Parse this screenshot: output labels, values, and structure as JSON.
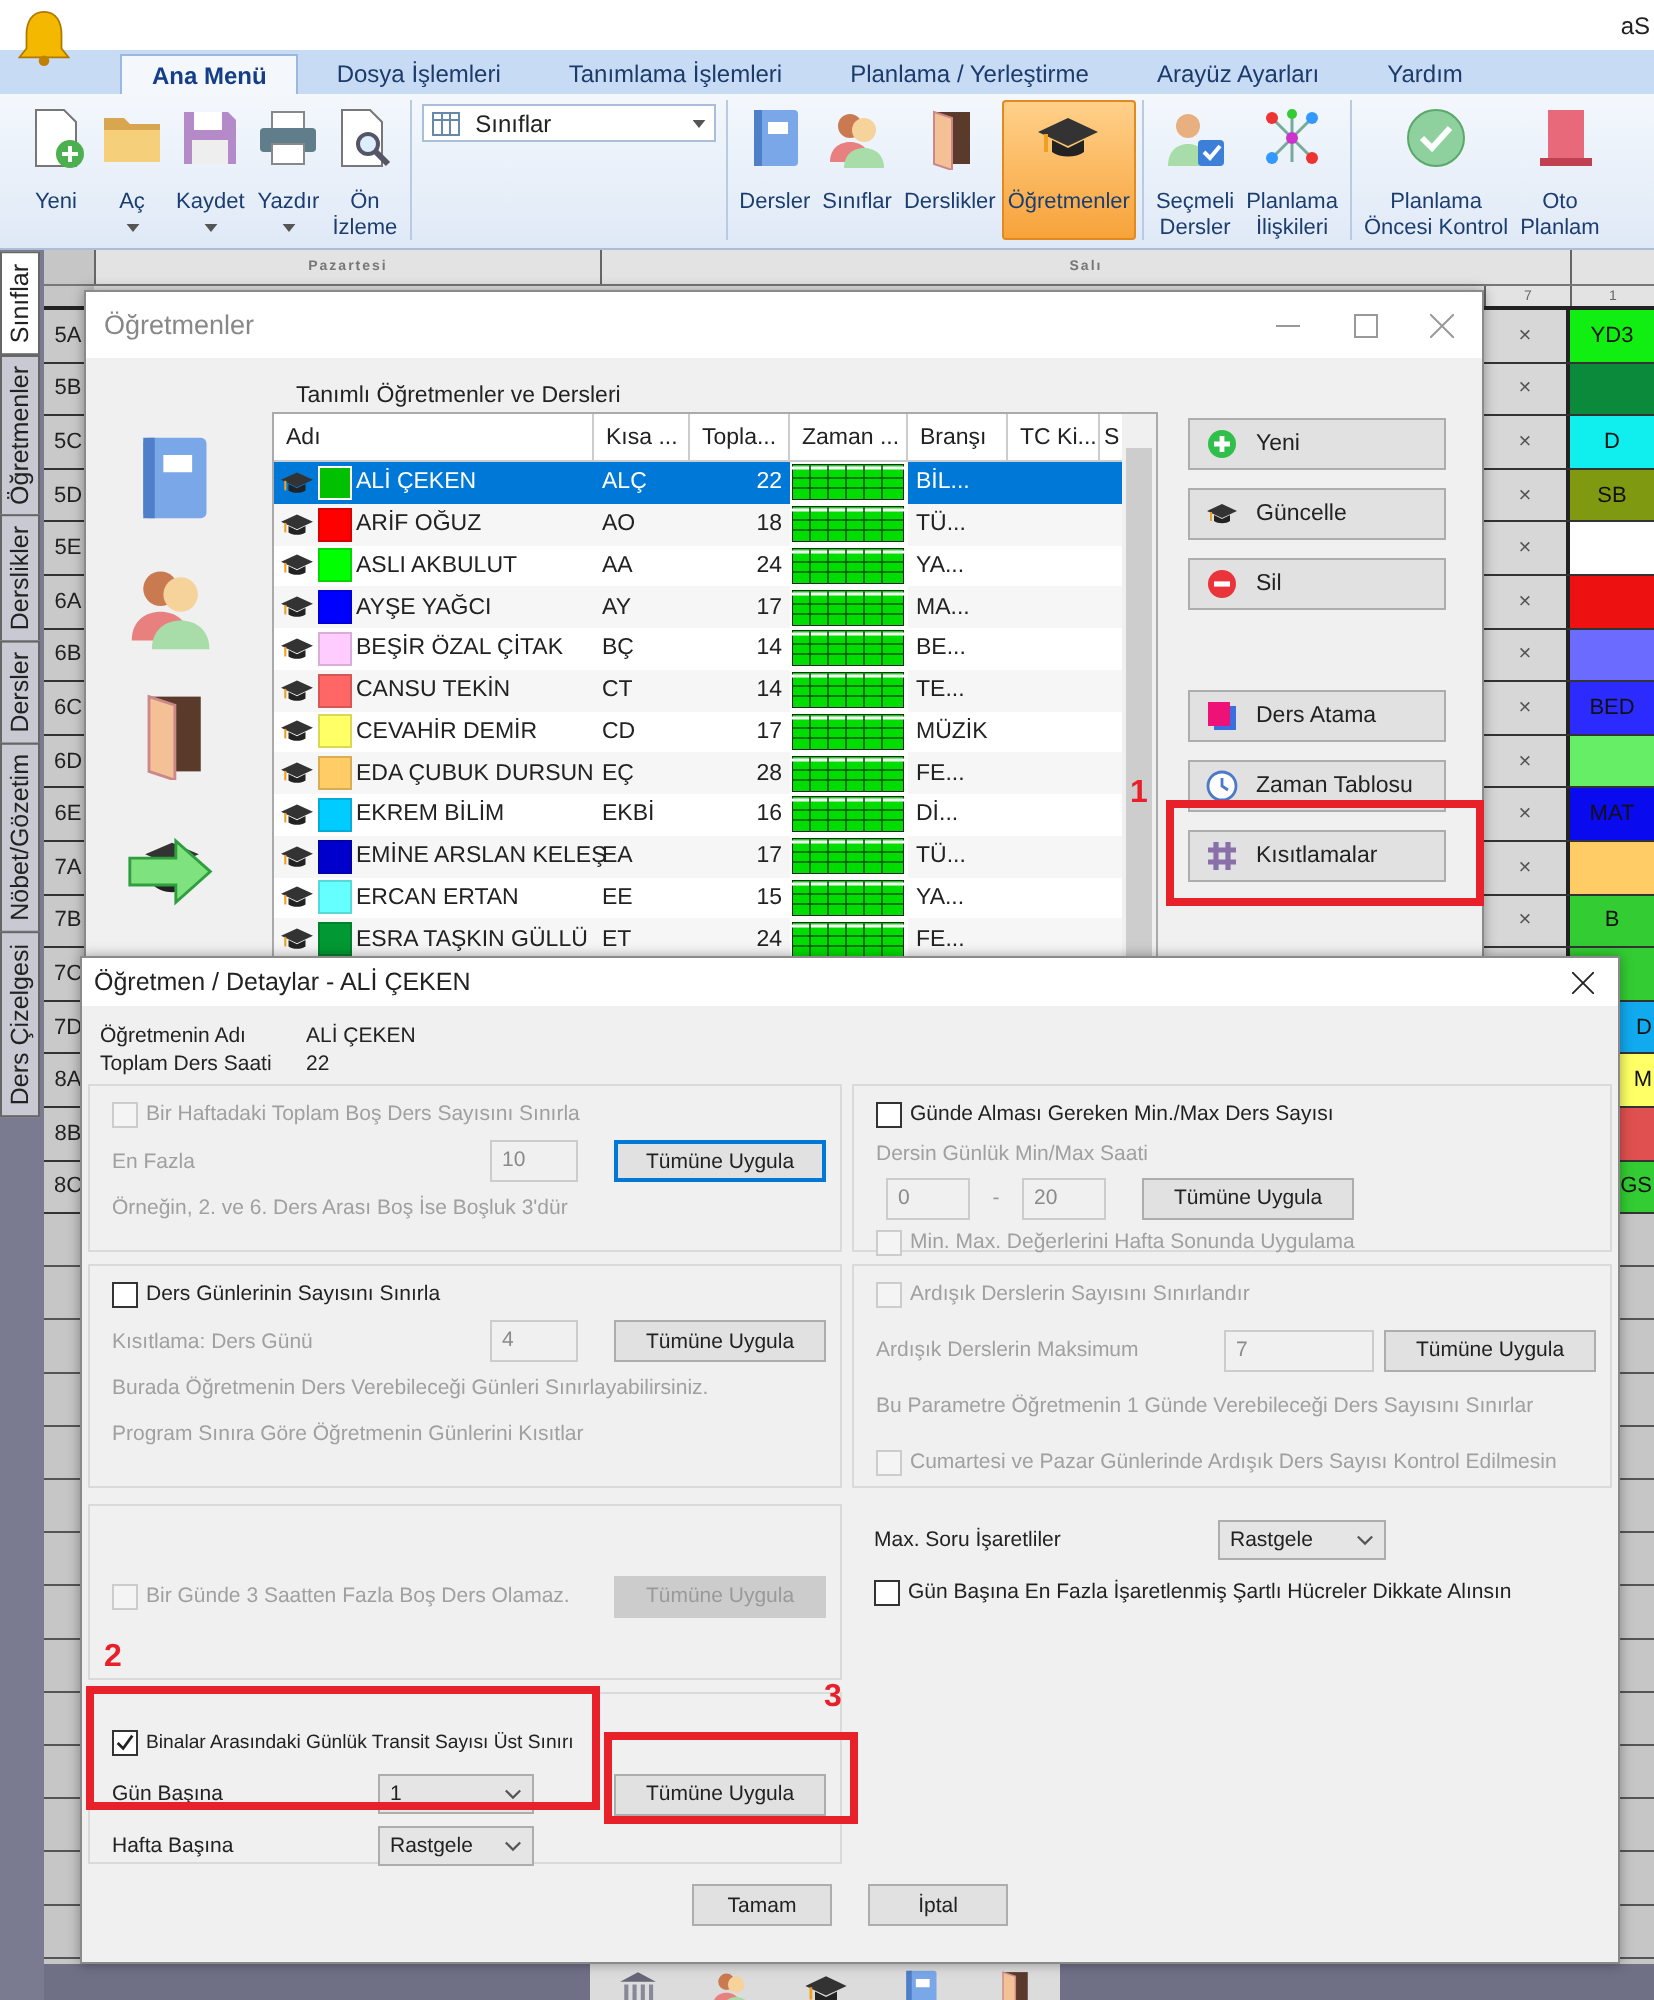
{
  "app": {
    "title": "aS"
  },
  "ribbon": {
    "tabs": [
      {
        "label": "Ana Menü",
        "selected": true
      },
      {
        "label": "Dosya İşlemleri",
        "selected": false
      },
      {
        "label": "Tanımlama İşlemleri",
        "selected": false
      },
      {
        "label": "Planlama / Yerleştirme",
        "selected": false
      },
      {
        "label": "Arayüz Ayarları",
        "selected": false
      },
      {
        "label": "Yardım",
        "selected": false
      }
    ],
    "groups": [
      {
        "kind": "buttons",
        "items": [
          {
            "label": "Yeni",
            "dropdown": false,
            "selected": false
          },
          {
            "label": "Aç",
            "dropdown": true,
            "selected": false
          },
          {
            "label": "Kaydet",
            "dropdown": true,
            "selected": false
          },
          {
            "label": "Yazdır",
            "dropdown": true,
            "selected": false
          },
          {
            "label": "Ön\nİzleme",
            "dropdown": false,
            "selected": false
          }
        ]
      },
      {
        "kind": "combo",
        "value": "Sınıflar"
      },
      {
        "kind": "buttons",
        "items": [
          {
            "label": "Dersler",
            "dropdown": false,
            "selected": false
          },
          {
            "label": "Sınıflar",
            "dropdown": false,
            "selected": false
          },
          {
            "label": "Derslikler",
            "dropdown": false,
            "selected": false
          },
          {
            "label": "Öğretmenler",
            "dropdown": false,
            "selected": true
          }
        ]
      },
      {
        "kind": "buttons",
        "items": [
          {
            "label": "Seçmeli\nDersler",
            "dropdown": false,
            "selected": false
          },
          {
            "label": "Planlama\nİlişkileri",
            "dropdown": false,
            "selected": false
          }
        ]
      },
      {
        "kind": "buttons",
        "items": [
          {
            "label": "Planlama\nÖncesi Kontrol",
            "dropdown": false,
            "selected": false
          },
          {
            "label": "Oto\nPlanlam",
            "dropdown": false,
            "selected": false
          }
        ]
      }
    ]
  },
  "side_tabs": [
    {
      "label": "Sınıflar",
      "selected": true
    },
    {
      "label": "Öğretmenler",
      "selected": false
    },
    {
      "label": "Derslikler",
      "selected": false
    },
    {
      "label": "Dersler",
      "selected": false
    },
    {
      "label": "Nöbet/Gözetim",
      "selected": false
    },
    {
      "label": "Ders Çizelgesi",
      "selected": false
    }
  ],
  "timetable": {
    "days": [
      "Pazartesi",
      "Salı"
    ],
    "periods": [
      "7",
      "1"
    ],
    "rows": [
      {
        "label": "5A",
        "mark": "×",
        "cell": "YD3",
        "color": "#11ee11"
      },
      {
        "label": "5B",
        "mark": "×",
        "color": "#0a8a3a"
      },
      {
        "label": "5C",
        "mark": "×",
        "cell": "D",
        "color": "#11eeee"
      },
      {
        "label": "5D",
        "mark": "×",
        "cell": "SB",
        "color": "#7f9a10"
      },
      {
        "label": "5E",
        "mark": "×",
        "color": "#ffffff"
      },
      {
        "label": "6A",
        "mark": "×",
        "color": "#ee1111"
      },
      {
        "label": "6B",
        "mark": "×",
        "color": "#6b6bff"
      },
      {
        "label": "6C",
        "mark": "×",
        "cell": "BED",
        "color": "#2b2bff"
      },
      {
        "label": "6D",
        "mark": "×",
        "color": "#66ee66"
      },
      {
        "label": "6E",
        "mark": "×",
        "cell": "MAT",
        "color": "#0a0aee"
      },
      {
        "label": "7A",
        "mark": "×",
        "color": "#ffcc66"
      },
      {
        "label": "7B",
        "mark": "×",
        "cell": "B",
        "color": "#33cc33"
      },
      {
        "label": "7C",
        "color": "#33cc33"
      },
      {
        "label": "7D",
        "cell": "D",
        "color": "#11aaee"
      },
      {
        "label": "8A",
        "cell": "M",
        "color": "#ffff66"
      },
      {
        "label": "8B",
        "color": "#e05050"
      },
      {
        "label": "8C",
        "cell": "GS",
        "color": "#33cc33"
      }
    ]
  },
  "teachers_window": {
    "title": "Öğretmenler",
    "caption": "Tanımlı Öğretmenler ve Dersleri",
    "columns": [
      "Adı",
      "Kısa ...",
      "Topla...",
      "Zaman ...",
      "Branşı",
      "TC Ki...",
      "S"
    ],
    "rows": [
      {
        "name": "ALİ ÇEKEN",
        "short": "ALÇ",
        "total": "22",
        "branch": "BİL...",
        "color": "#00c000",
        "selected": true
      },
      {
        "name": "ARİF OĞUZ",
        "short": "AO",
        "total": "18",
        "branch": "TÜ...",
        "color": "#ff0000",
        "selected": false
      },
      {
        "name": "ASLI AKBULUT",
        "short": "AA",
        "total": "24",
        "branch": "YA...",
        "color": "#00ff00",
        "selected": false
      },
      {
        "name": "AYŞE YAĞCI",
        "short": "AY",
        "total": "17",
        "branch": "MA...",
        "color": "#0000ff",
        "selected": false
      },
      {
        "name": "BEŞİR ÖZAL ÇİTAK",
        "short": "BÇ",
        "total": "14",
        "branch": "BE...",
        "color": "#ffccff",
        "selected": false
      },
      {
        "name": "CANSU TEKİN",
        "short": "CT",
        "total": "14",
        "branch": "TE...",
        "color": "#ff6666",
        "selected": false
      },
      {
        "name": "CEVAHİR DEMİR",
        "short": "CD",
        "total": "17",
        "branch": "MÜZİK",
        "color": "#ffff66",
        "selected": false
      },
      {
        "name": "EDA ÇUBUK DURSUN",
        "short": "EÇ",
        "total": "28",
        "branch": "FE...",
        "color": "#ffcc66",
        "selected": false
      },
      {
        "name": "EKREM BİLİM",
        "short": "EKBİ",
        "total": "16",
        "branch": "Dİ...",
        "color": "#00ccff",
        "selected": false
      },
      {
        "name": "EMİNE ARSLAN KELEŞ",
        "short": "EA",
        "total": "17",
        "branch": "TÜ...",
        "color": "#0000cc",
        "selected": false
      },
      {
        "name": "ERCAN ERTAN",
        "short": "EE",
        "total": "15",
        "branch": "YA...",
        "color": "#66ffff",
        "selected": false
      },
      {
        "name": "ESRA TAŞKIN GÜLLÜ",
        "short": "ET",
        "total": "24",
        "branch": "FE...",
        "color": "#009933",
        "selected": false
      }
    ],
    "buttons": [
      [
        "Yeni",
        "Güncelle",
        "Sil"
      ],
      [
        "Ders Atama",
        "Zaman Tablosu",
        "Kısıtlamalar"
      ]
    ]
  },
  "detail_dialog": {
    "title": "Öğretmen / Detaylar - ALİ ÇEKEN",
    "info": [
      {
        "label": "Öğretmenin Adı",
        "value": "ALİ ÇEKEN"
      },
      {
        "label": "Toplam Ders Saati",
        "value": "22"
      }
    ],
    "left_sections": [
      {
        "framed": true,
        "lines": [
          [
            {
              "kind": "checkbox",
              "label": "Bir Haftadaki Toplam Boş Ders Sayısını Sınırla",
              "checked": false,
              "disabled": true
            }
          ],
          [
            {
              "kind": "label",
              "text": "En Fazla",
              "disabled": true
            },
            {
              "kind": "input",
              "value": "10",
              "disabled": true
            },
            {
              "kind": "button",
              "label": "Tümüne Uygula",
              "focused": true,
              "disabled": false
            }
          ],
          [
            {
              "kind": "note",
              "text": "Örneğin, 2. ve 6. Ders Arası Boş İse Boşluk 3'dür",
              "disabled": true
            }
          ]
        ]
      },
      {
        "framed": true,
        "lines": [
          [
            {
              "kind": "checkbox",
              "label": "Ders Günlerinin Sayısını Sınırla",
              "checked": false,
              "disabled": false
            }
          ],
          [
            {
              "kind": "label",
              "text": "Kısıtlama: Ders Günü",
              "disabled": true
            },
            {
              "kind": "input",
              "value": "4",
              "disabled": true
            },
            {
              "kind": "button",
              "label": "Tümüne Uygula",
              "focused": false,
              "disabled": false
            }
          ],
          [
            {
              "kind": "note",
              "text": "Burada Öğretmenin Ders Verebileceği Günleri Sınırlayabilirsiniz.",
              "disabled": true
            }
          ],
          [
            {
              "kind": "note",
              "text": "Program Sınıra Göre Öğretmenin Günlerini Kısıtlar",
              "disabled": true
            }
          ]
        ]
      },
      {
        "framed": true,
        "lines": [
          [
            {
              "kind": "checkbox",
              "label": "Bir Günde 3 Saatten Fazla Boş Ders Olamaz.",
              "checked": false,
              "disabled": true
            },
            {
              "kind": "button",
              "label": "Tümüne Uygula",
              "focused": false,
              "disabled": true
            }
          ]
        ]
      },
      {
        "framed": true,
        "lines": [
          [
            {
              "kind": "checkbox",
              "label": "Binalar Arasındaki Günlük Transit Sayısı Üst Sınırı",
              "checked": true,
              "disabled": false
            }
          ],
          [
            {
              "kind": "label",
              "text": "Gün Başına",
              "disabled": false
            },
            {
              "kind": "select",
              "value": "1"
            },
            {
              "kind": "button",
              "label": "Tümüne Uygula",
              "focused": false,
              "disabled": false
            }
          ],
          [
            {
              "kind": "label",
              "text": "Hafta Başına",
              "disabled": false
            },
            {
              "kind": "select",
              "value": "Rastgele"
            }
          ]
        ]
      }
    ],
    "right_sections": [
      {
        "framed": true,
        "lines": [
          [
            {
              "kind": "checkbox",
              "label": "Günde Alması Gereken Min./Max Ders Sayısı",
              "checked": false,
              "disabled": false
            }
          ],
          [
            {
              "kind": "label",
              "text": "Dersin Günlük Min/Max Saati",
              "disabled": true
            }
          ],
          [
            {
              "kind": "input",
              "value": "0",
              "disabled": true
            },
            {
              "kind": "dash",
              "text": "-"
            },
            {
              "kind": "input",
              "value": "20",
              "disabled": true
            },
            {
              "kind": "button",
              "label": "Tümüne Uygula",
              "focused": false,
              "disabled": false
            }
          ],
          [
            {
              "kind": "checkbox",
              "label": "Min. Max. Değerlerini Hafta Sonunda Uygulama",
              "checked": false,
              "disabled": true
            }
          ]
        ]
      },
      {
        "framed": true,
        "lines": [
          [
            {
              "kind": "checkbox",
              "label": "Ardışık Derslerin Sayısını Sınırlandır",
              "checked": false,
              "disabled": true
            }
          ],
          [
            {
              "kind": "label",
              "text": "Ardışık Derslerin Maksimum",
              "disabled": true
            },
            {
              "kind": "input",
              "value": "7",
              "disabled": true
            },
            {
              "kind": "button",
              "label": "Tümüne Uygula",
              "focused": false,
              "disabled": false
            }
          ],
          [
            {
              "kind": "note",
              "text": "Bu Parametre Öğretmenin 1 Günde Verebileceği Ders Sayısını Sınırlar",
              "disabled": true
            }
          ],
          [
            {
              "kind": "checkbox",
              "label": "Cumartesi ve Pazar Günlerinde Ardışık Ders Sayısı Kontrol Edilmesin",
              "checked": false,
              "disabled": true
            }
          ]
        ]
      },
      {
        "framed": false,
        "lines": [
          [
            {
              "kind": "label",
              "text": "Max. Soru İşaretliler",
              "disabled": false
            },
            {
              "kind": "select",
              "value": "Rastgele"
            }
          ],
          [
            {
              "kind": "checkbox",
              "label": "Gün Başına En Fazla İşaretlenmiş Şartlı Hücreler Dikkate Alınsın",
              "checked": false,
              "disabled": false
            }
          ]
        ]
      }
    ],
    "buttons": [
      "Tamam",
      "İptal"
    ]
  },
  "callouts": [
    "1",
    "2",
    "3"
  ]
}
